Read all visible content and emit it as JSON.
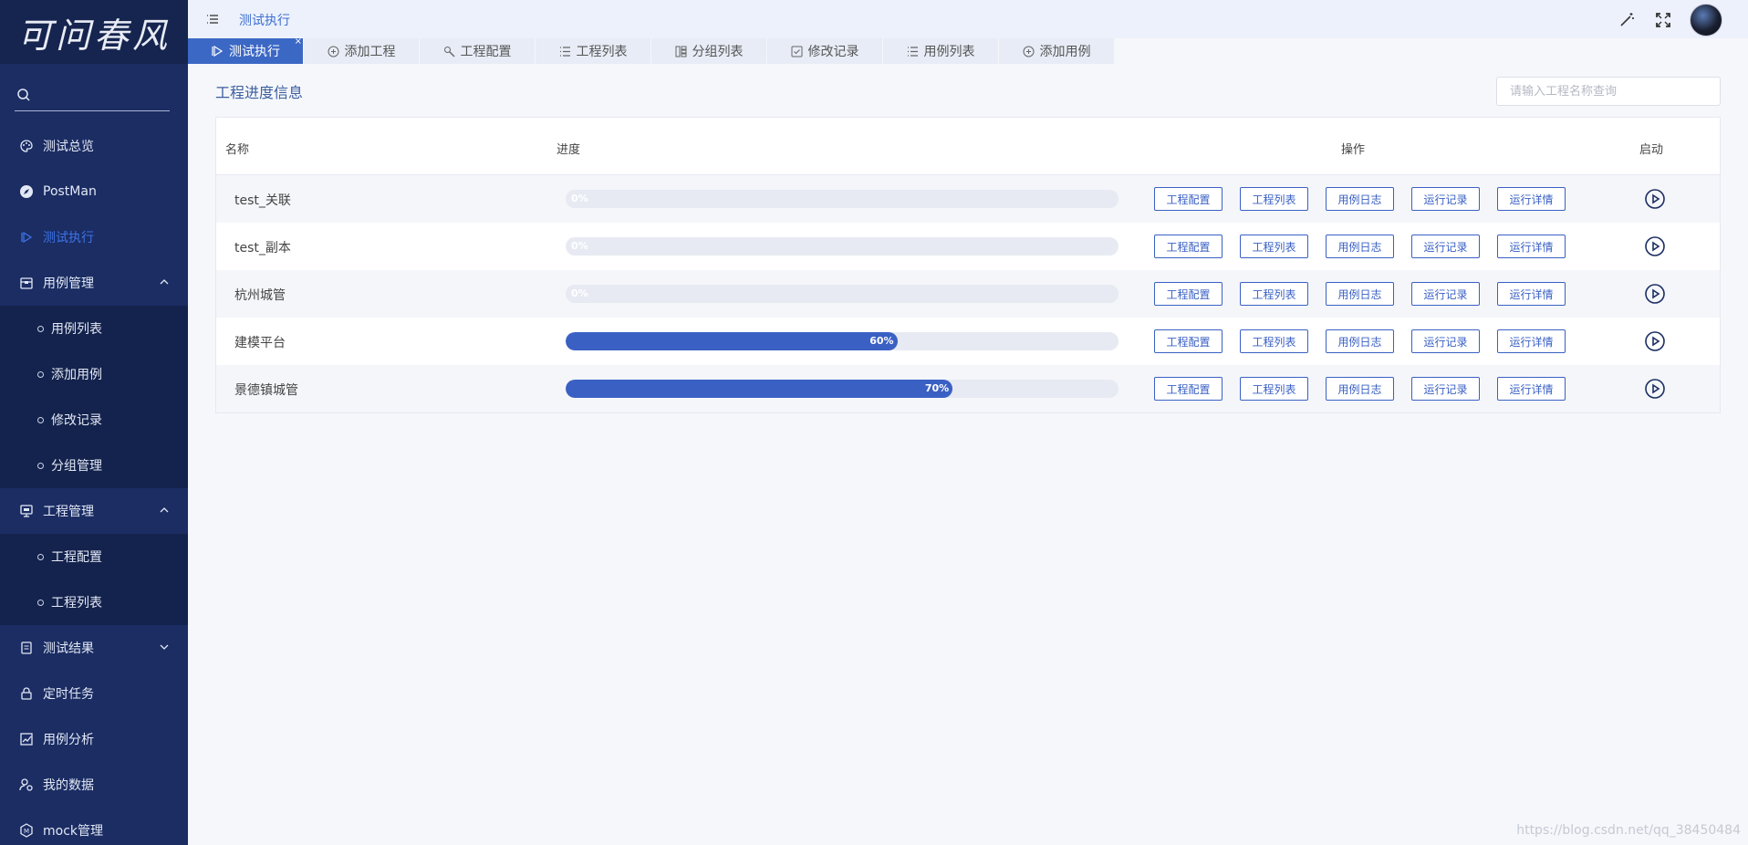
{
  "sidebar": {
    "logo_text": "可问春风",
    "items": [
      {
        "label": "测试总览",
        "icon": "palette-icon"
      },
      {
        "label": "PostMan",
        "icon": "compass-icon"
      },
      {
        "label": "测试执行",
        "icon": "play-outline-icon",
        "active": true
      },
      {
        "label": "用例管理",
        "icon": "box-icon",
        "expanded": true
      },
      {
        "label": "工程管理",
        "icon": "monitor-icon",
        "expanded": true
      },
      {
        "label": "测试结果",
        "icon": "clipboard-icon"
      },
      {
        "label": "定时任务",
        "icon": "lock-icon"
      },
      {
        "label": "用例分析",
        "icon": "chart-icon"
      },
      {
        "label": "我的数据",
        "icon": "user-gear-icon"
      },
      {
        "label": "mock管理",
        "icon": "m-badge-icon"
      }
    ],
    "case_sub": [
      "用例列表",
      "添加用例",
      "修改记录",
      "分组管理"
    ],
    "project_sub": [
      "工程配置",
      "工程列表"
    ]
  },
  "topbar": {
    "breadcrumb": "测试执行"
  },
  "tabs": [
    {
      "label": "测试执行",
      "active": true
    },
    {
      "label": "添加工程"
    },
    {
      "label": "工程配置"
    },
    {
      "label": "工程列表"
    },
    {
      "label": "分组列表"
    },
    {
      "label": "修改记录"
    },
    {
      "label": "用例列表"
    },
    {
      "label": "添加用例"
    }
  ],
  "main": {
    "title": "工程进度信息",
    "search_placeholder": "请输入工程名称查询",
    "columns": {
      "name": "名称",
      "progress": "进度",
      "actions": "操作",
      "start": "启动"
    },
    "action_labels": [
      "工程配置",
      "工程列表",
      "用例日志",
      "运行记录",
      "运行详情"
    ],
    "rows": [
      {
        "name": "test_关联",
        "progress": 0,
        "progress_label": "0%"
      },
      {
        "name": "test_副本",
        "progress": 0,
        "progress_label": "0%"
      },
      {
        "name": "杭州城管",
        "progress": 0,
        "progress_label": "0%"
      },
      {
        "name": "建模平台",
        "progress": 60,
        "progress_label": "60%"
      },
      {
        "name": "景德镇城管",
        "progress": 70,
        "progress_label": "70%"
      }
    ]
  },
  "watermark": "https://blog.csdn.net/qq_38450484",
  "colors": {
    "sidebar": "#1b2d63",
    "accent": "#3a60c4",
    "active_menu": "#3e73e6"
  }
}
